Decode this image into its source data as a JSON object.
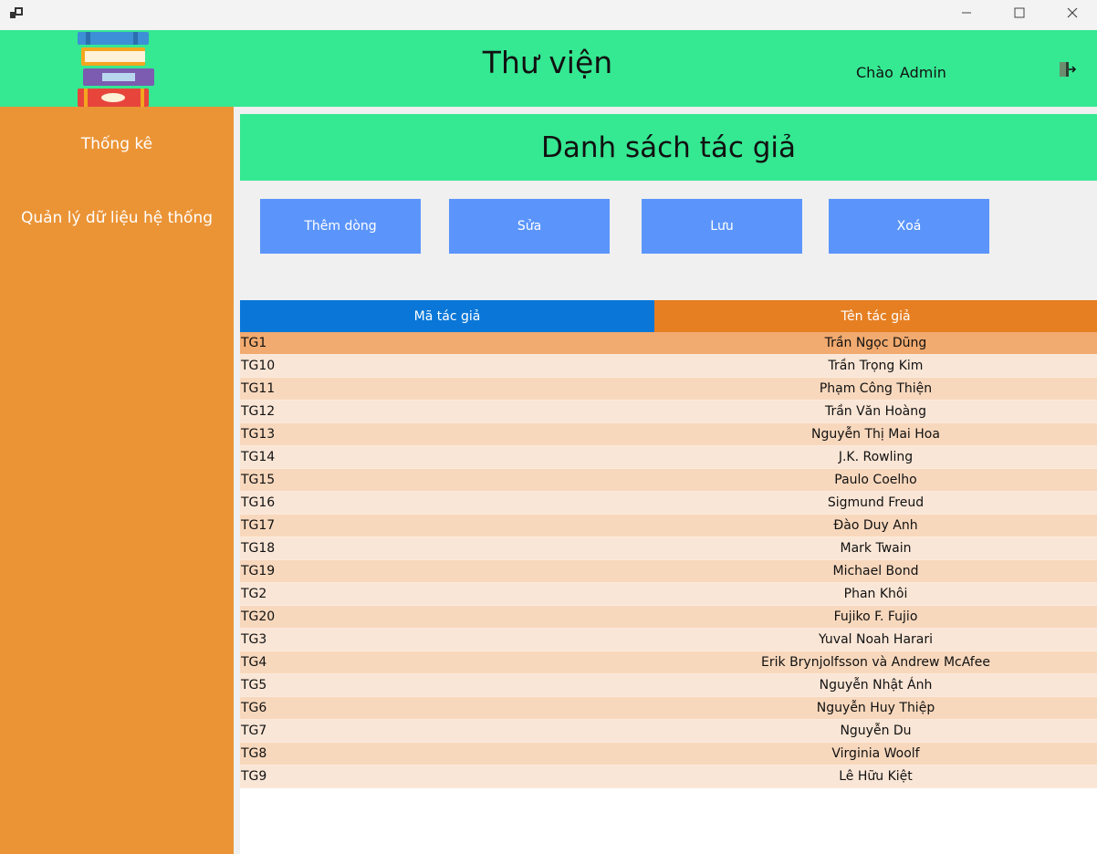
{
  "window": {
    "minimize_glyph": "—",
    "maximize_glyph": "☐",
    "close_glyph": "✕"
  },
  "header": {
    "title": "Thư viện",
    "greeting": "Chào",
    "user": "Admin",
    "logout_icon": "logout-icon",
    "logo_icon": "books-icon"
  },
  "sidebar": {
    "items": [
      {
        "label": "Thống kê"
      },
      {
        "label": "Quản lý dữ liệu hệ thống"
      }
    ]
  },
  "main": {
    "section_title": "Danh sách tác giả",
    "buttons": {
      "add": "Thêm dòng",
      "edit": "Sửa",
      "save": "Lưu",
      "delete": "Xoá"
    },
    "table": {
      "columns": [
        "Mã tác giả",
        "Tên tác giả"
      ],
      "rows": [
        [
          "TG1",
          "Trần Ngọc Dũng"
        ],
        [
          "TG10",
          "Trần Trọng Kim"
        ],
        [
          "TG11",
          "Phạm Công Thiện"
        ],
        [
          "TG12",
          "Trần Văn Hoàng"
        ],
        [
          "TG13",
          "Nguyễn Thị Mai Hoa"
        ],
        [
          "TG14",
          "J.K. Rowling"
        ],
        [
          "TG15",
          "Paulo Coelho"
        ],
        [
          "TG16",
          "Sigmund Freud"
        ],
        [
          "TG17",
          "Đào Duy Anh"
        ],
        [
          "TG18",
          "Mark Twain"
        ],
        [
          "TG19",
          "Michael Bond"
        ],
        [
          "TG2",
          "Phan Khôi"
        ],
        [
          "TG20",
          "Fujiko F. Fujio"
        ],
        [
          "TG3",
          "Yuval Noah Harari"
        ],
        [
          "TG4",
          "Erik Brynjolfsson và Andrew McAfee"
        ],
        [
          "TG5",
          "Nguyễn Nhật Ánh"
        ],
        [
          "TG6",
          "Nguyễn Huy Thiệp"
        ],
        [
          "TG7",
          "Nguyễn Du"
        ],
        [
          "TG8",
          "Virginia Woolf"
        ],
        [
          "TG9",
          "Lê Hữu Kiệt"
        ]
      ],
      "selected_row": 0
    }
  },
  "colors": {
    "header_green": "#35e892",
    "sidebar_orange": "#eb9436",
    "button_blue": "#5b95fb",
    "col1_head": "#0a77d8",
    "col2_head": "#e67f22"
  }
}
